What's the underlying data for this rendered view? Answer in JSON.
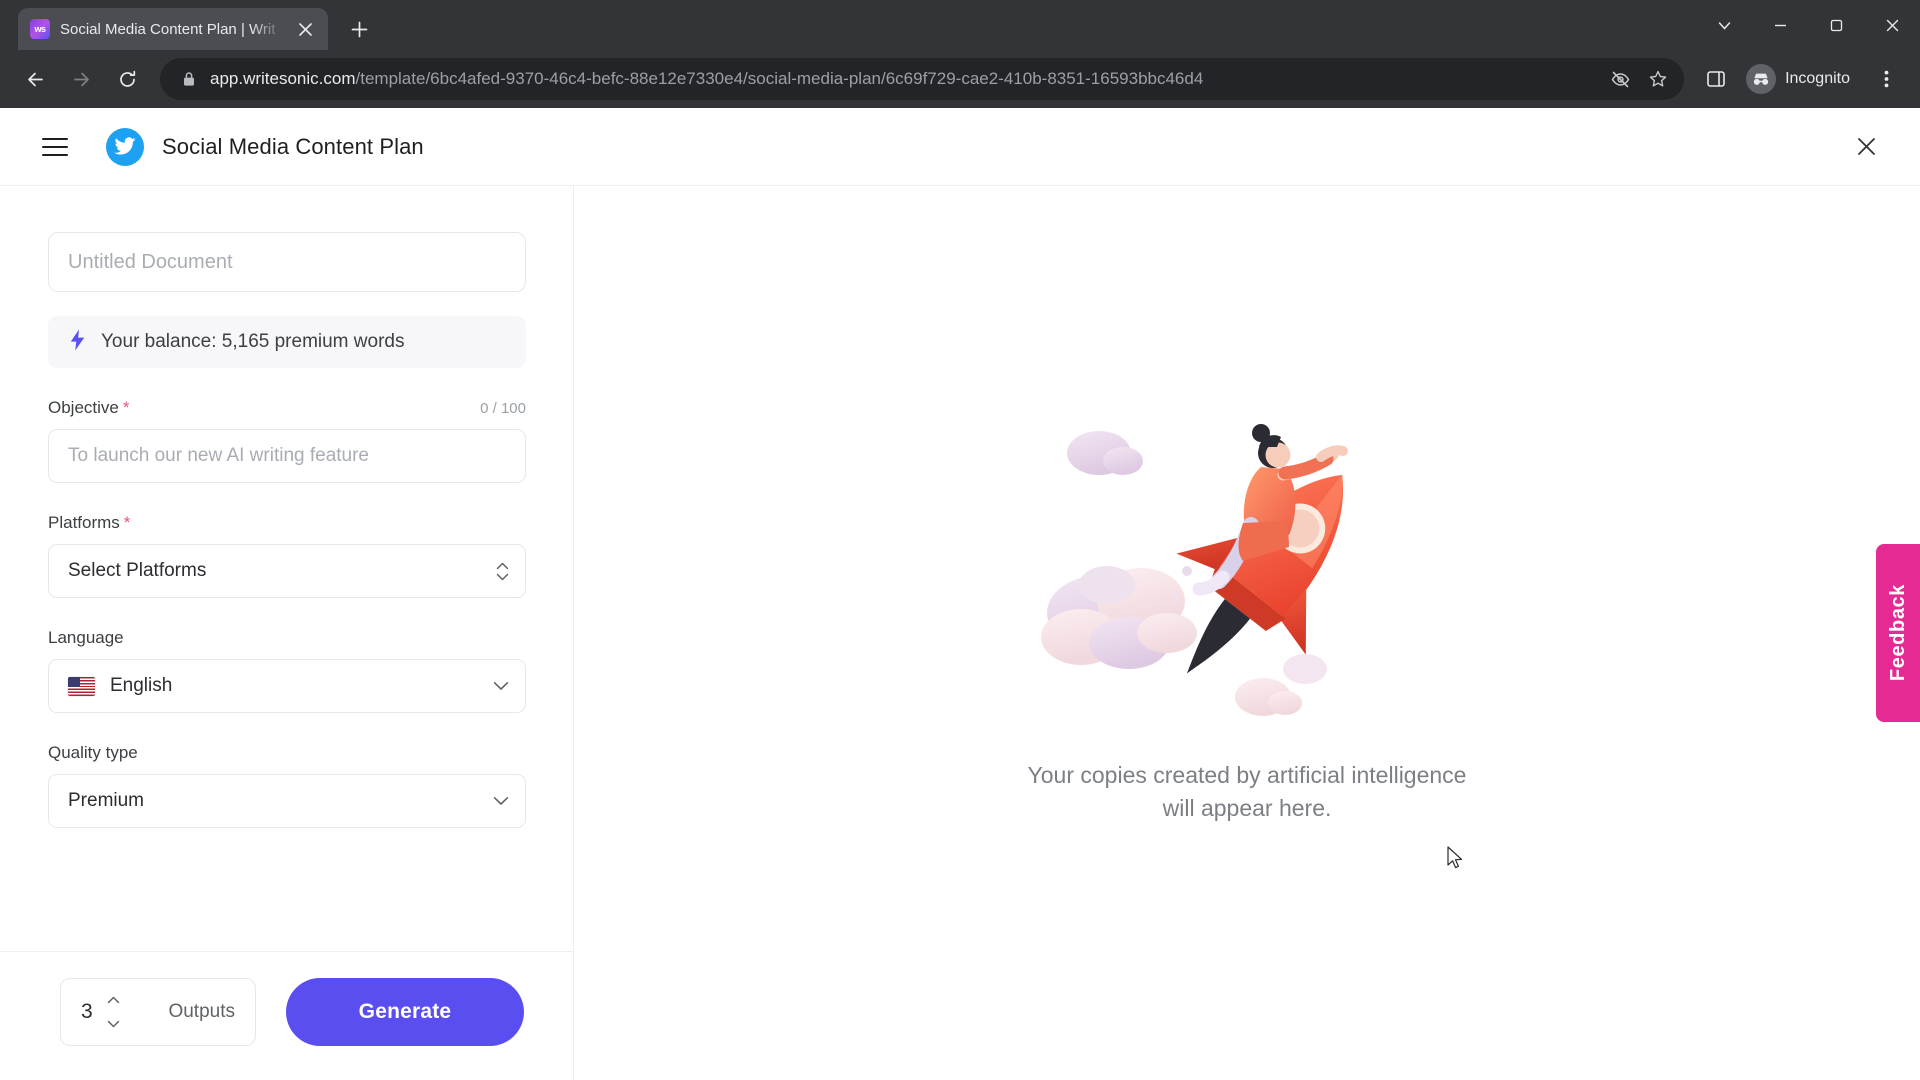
{
  "browser": {
    "tab": {
      "title": "Social Media Content Plan | Writ",
      "favicon_label": "ws",
      "close_icon": "close-icon"
    },
    "new_tab_label": "+",
    "window_controls": [
      "chevron-down-icon",
      "minimize-icon",
      "maximize-icon",
      "close-icon"
    ],
    "nav": {
      "back": "back-arrow-icon",
      "forward": "forward-arrow-icon",
      "reload": "reload-icon"
    },
    "omnibox": {
      "lock_icon": "lock-icon",
      "host": "app.writesonic.com",
      "path": "/template/6bc4afed-9370-46c4-befc-88e12e7330e4/social-media-plan/6c69f729-cae2-410b-8351-16593bbc46d4",
      "trailing_icons": [
        "third-party-cookie-blocked-icon",
        "bookmark-star-icon"
      ]
    },
    "toolbar_right": {
      "side_panel_icon": "side-panel-icon",
      "incognito_label": "Incognito",
      "menu_icon": "three-dot-menu-icon"
    }
  },
  "app": {
    "header": {
      "menu_icon": "hamburger-menu-icon",
      "brand_icon": "twitter-bird-icon",
      "title": "Social Media Content Plan",
      "close_icon": "close-icon"
    },
    "form": {
      "document_title_placeholder": "Untitled Document",
      "document_title_value": "",
      "balance": {
        "icon": "lightning-bolt-icon",
        "text": "Your balance: 5,165 premium words"
      },
      "objective": {
        "label": "Objective",
        "required_mark": "*",
        "counter": "0 / 100",
        "placeholder": "To launch our new AI writing feature",
        "value": ""
      },
      "platforms": {
        "label": "Platforms",
        "required_mark": "*",
        "value": "Select Platforms",
        "chevron_icon": "chevron-up-down-icon"
      },
      "language": {
        "label": "Language",
        "value": "English",
        "flag_icon": "us-flag-icon",
        "chevron_icon": "chevron-down-icon"
      },
      "quality_type": {
        "label": "Quality type",
        "value": "Premium",
        "chevron_icon": "chevron-down-icon"
      }
    },
    "footer": {
      "outputs_value": "3",
      "outputs_label": "Outputs",
      "stepper_up_icon": "chevron-up-icon",
      "stepper_down_icon": "chevron-down-icon",
      "generate_label": "Generate"
    },
    "results": {
      "illustration": "rocket-launch-illustration",
      "empty_line_1": "Your copies created by artificial intelligence",
      "empty_line_2": "will appear here."
    },
    "feedback_tab": {
      "label": "Feedback",
      "color": "#e62a94"
    },
    "colors": {
      "accent": "#5b4ef0",
      "brand": "#1DA1F2",
      "required": "#e8537e",
      "feedback": "#e62a94"
    }
  }
}
